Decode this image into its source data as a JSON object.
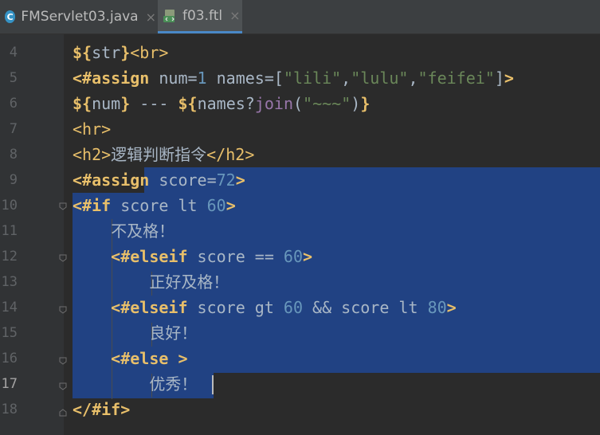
{
  "tabs": [
    {
      "label": "FMServlet03.java",
      "icon": "java-class-icon",
      "active": false
    },
    {
      "label": "f03.ftl",
      "icon": "ftl-file-icon",
      "active": true
    }
  ],
  "editor": {
    "selection_color": "#214283",
    "current_line": "17",
    "lines": [
      {
        "no": "4",
        "text": "${str}<br>"
      },
      {
        "no": "5",
        "text": "<#assign num=1 names=[\"lili\",\"lulu\",\"feifei\"]>"
      },
      {
        "no": "6",
        "text": "${num} --- ${names?join(\"~~~\")}"
      },
      {
        "no": "7",
        "text": "<hr>"
      },
      {
        "no": "8",
        "text": "<h2>逻辑判断指令</h2>"
      },
      {
        "no": "9",
        "text": "<#assign score=72>"
      },
      {
        "no": "10",
        "text": "<#if score lt 60>"
      },
      {
        "no": "11",
        "text": "    不及格！"
      },
      {
        "no": "12",
        "text": "    <#elseif score == 60>"
      },
      {
        "no": "13",
        "text": "        正好及格！"
      },
      {
        "no": "14",
        "text": "    <#elseif score gt 60 && score lt 80>"
      },
      {
        "no": "15",
        "text": "        良好！"
      },
      {
        "no": "16",
        "text": "    <#else >"
      },
      {
        "no": "17",
        "text": "        优秀！"
      },
      {
        "no": "18",
        "text": "</#if>"
      }
    ]
  }
}
